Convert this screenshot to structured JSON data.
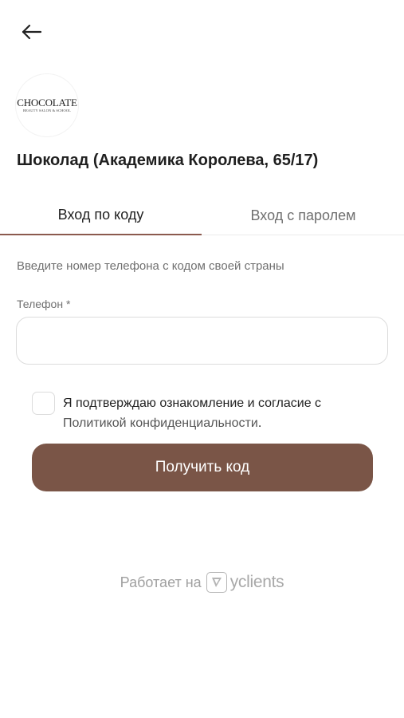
{
  "header": {
    "back_icon": "arrow-left-icon"
  },
  "salon": {
    "logo_name": "CHOCOLATE",
    "logo_sub": "BEAUTY SALON & SCHOOL",
    "title": "Шоколад (Академика Королева, 65/17)"
  },
  "tabs": [
    {
      "label": "Вход по коду",
      "active": true
    },
    {
      "label": "Вход с паролем",
      "active": false
    }
  ],
  "form": {
    "hint": "Введите номер телефона с кодом своей страны",
    "phone_label": "Телефон *",
    "phone_value": "",
    "phone_placeholder": "",
    "consent_text": "Я подтверждаю ознакомление и согласие с ",
    "consent_link": "Политикой конфиденциальности",
    "consent_end": ".",
    "submit_label": "Получить код"
  },
  "footer": {
    "powered_by": "Работает на",
    "brand": "yclients",
    "brand_icon": "yclients-logo-icon"
  },
  "colors": {
    "accent": "#7a5547",
    "tab_underline": "#8b5a4e"
  }
}
